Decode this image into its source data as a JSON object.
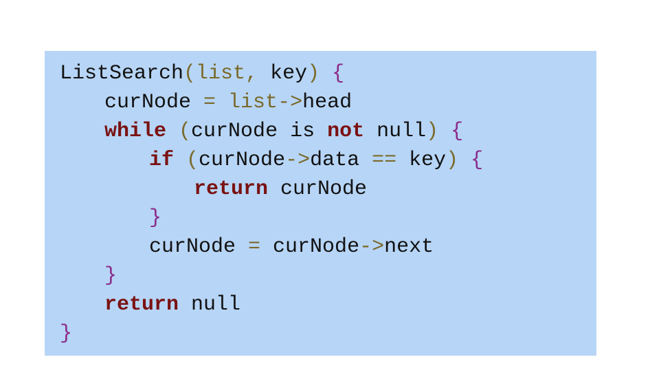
{
  "code": {
    "line1": {
      "fn": "ListSearch",
      "open_paren": "(",
      "param_list": "list",
      "comma": ",",
      "param_key": " key",
      "close_paren": ")",
      "space": " ",
      "brace": "{"
    },
    "line2": {
      "var": "curNode",
      "eq": " = ",
      "obj": "list",
      "arrow": "->",
      "field": "head"
    },
    "line3": {
      "kw_while": "while",
      "sp1": " ",
      "open_paren": "(",
      "text1": "curNode is ",
      "kw_not": "not",
      "text2": " null",
      "close_paren": ")",
      "sp2": " ",
      "brace": "{"
    },
    "line4": {
      "kw_if": "if",
      "sp1": " ",
      "open_paren": "(",
      "obj": "curNode",
      "arrow": "->",
      "field": "data",
      "eqeq": " == ",
      "key": "key",
      "close_paren": ")",
      "sp2": " ",
      "brace": "{"
    },
    "line5": {
      "kw_return": "return",
      "value": " curNode"
    },
    "line6": {
      "brace": "}"
    },
    "line7": {
      "var": "curNode",
      "eq": " = ",
      "obj": "curNode",
      "arrow": "->",
      "field": "next"
    },
    "line8": {
      "brace": "}"
    },
    "line9": {
      "kw_return": "return",
      "value": " null"
    },
    "line10": {
      "brace": "}"
    }
  },
  "colors": {
    "background": "#b7d5f6",
    "keyword": "#7a1212",
    "operator": "#7a6a2a",
    "brace": "#8a2a8a",
    "text": "#111111"
  }
}
